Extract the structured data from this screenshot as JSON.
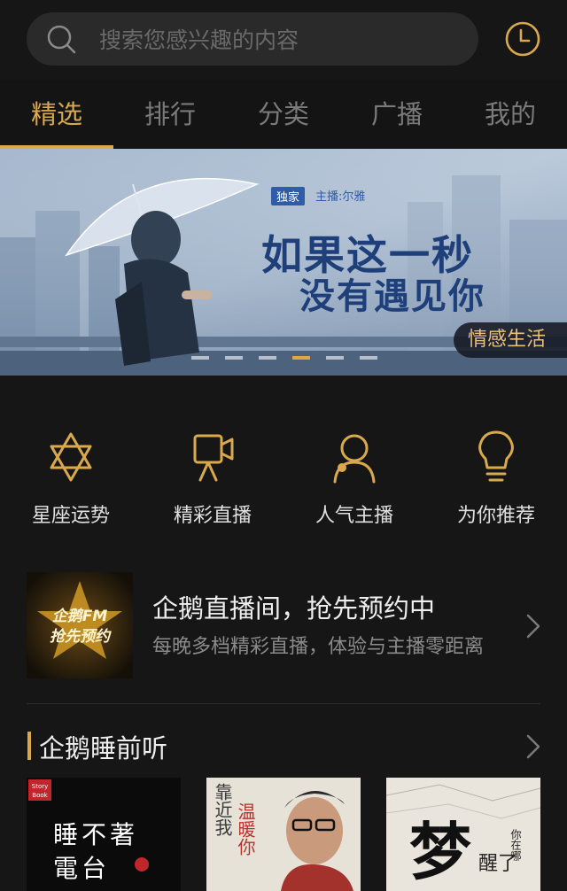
{
  "search": {
    "placeholder": "搜索您感兴趣的内容"
  },
  "icons": {
    "search": "search-icon",
    "history": "clock-icon"
  },
  "tabs": [
    {
      "label": "精选",
      "active": true
    },
    {
      "label": "排行",
      "active": false
    },
    {
      "label": "分类",
      "active": false
    },
    {
      "label": "广播",
      "active": false
    },
    {
      "label": "我的",
      "active": false
    }
  ],
  "banner": {
    "exclusive": "独家",
    "host": "主播:尔雅",
    "title_line1": "如果这一秒",
    "title_line2": "没有遇见你",
    "tag": "情感生活",
    "slide_count": 6,
    "active_slide": 3
  },
  "quick_entries": [
    {
      "label": "星座运势",
      "icon": "star-of-david-icon"
    },
    {
      "label": "精彩直播",
      "icon": "video-camera-icon"
    },
    {
      "label": "人气主播",
      "icon": "person-icon"
    },
    {
      "label": "为你推荐",
      "icon": "lightbulb-icon"
    }
  ],
  "promo": {
    "title": "企鹅直播间，抢先预约中",
    "subtitle": "每晚多档精彩直播，体验与主播零距离",
    "thumb_text_line1": "企鹅FM",
    "thumb_text_line2": "抢先预约"
  },
  "section": {
    "title": "企鹅睡前听"
  },
  "cards": [
    {
      "badge_line1": "Story",
      "badge_line2": "Book",
      "text_line1": "睡不著",
      "text_line2": "電台"
    },
    {
      "text_col1": "靠近我",
      "text_col2": "温暖你"
    },
    {
      "big_char": "梦",
      "text_line1": "醒了",
      "text_line2": "你在哪"
    }
  ],
  "colors": {
    "accent": "#d9a94b",
    "background": "#161616"
  }
}
